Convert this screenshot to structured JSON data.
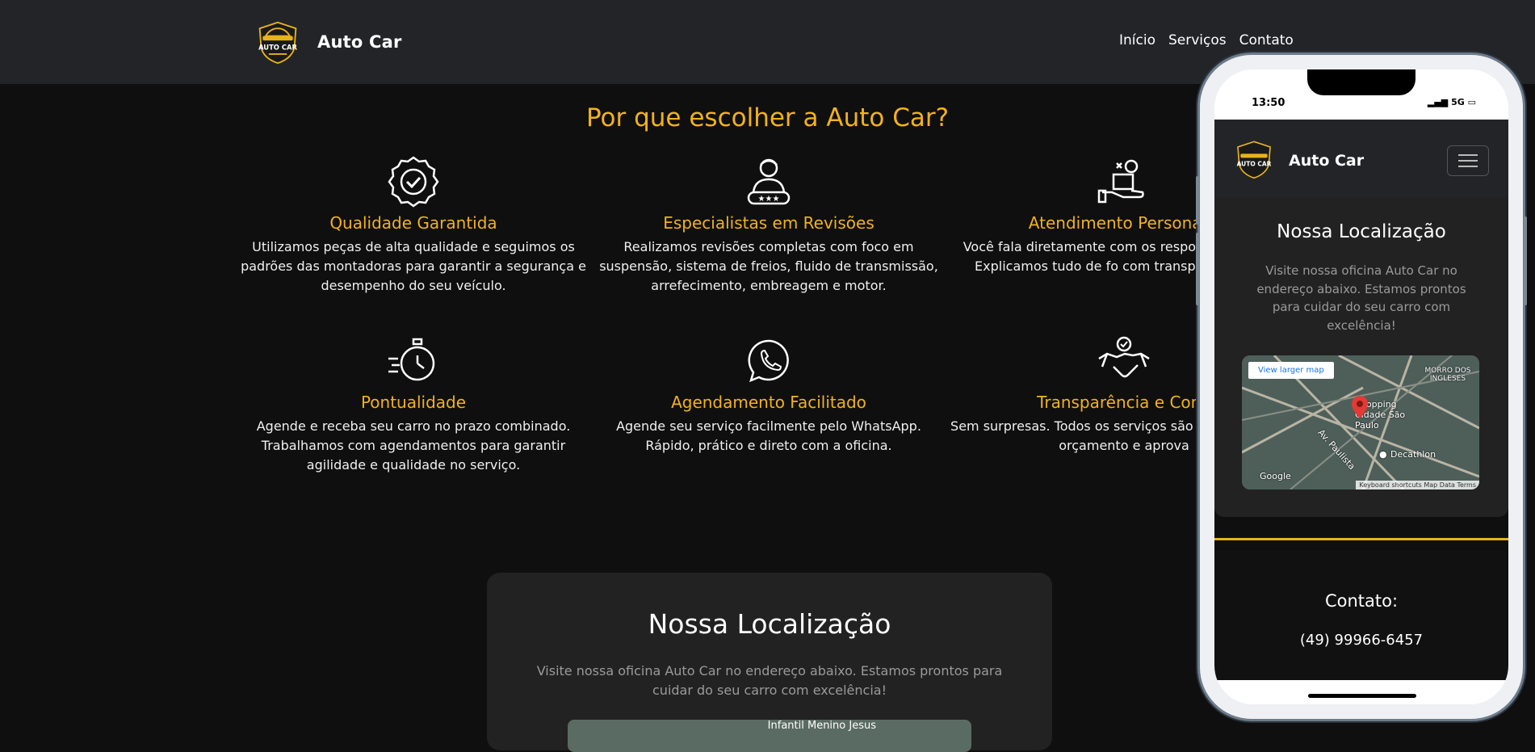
{
  "header": {
    "logo_text": "AUTO CAR",
    "brand": "Auto Car",
    "nav": [
      "Início",
      "Serviços",
      "Contato"
    ]
  },
  "why": {
    "title": "Por que escolher a Auto Car?",
    "features": [
      {
        "icon": "quality-badge-icon",
        "title": "Qualidade Garantida",
        "text": "Utilizamos peças de alta qualidade e seguimos os padrões das montadoras para garantir a segurança e desempenho do seu veículo."
      },
      {
        "icon": "specialist-icon",
        "title": "Especialistas em Revisões",
        "text": "Realizamos revisões completas com foco em suspensão, sistema de freios, fluido de transmissão, arrefecimento, embreagem e motor."
      },
      {
        "icon": "personal-service-icon",
        "title": "Atendimento Personaliz",
        "text": "Você fala diretamente com os respo manutenção. Explicamos tudo de fo com transparência tota"
      },
      {
        "icon": "stopwatch-icon",
        "title": "Pontualidade",
        "text": "Agende e receba seu carro no prazo combinado. Trabalhamos com agendamentos para garantir agilidade e qualidade no serviço."
      },
      {
        "icon": "whatsapp-icon",
        "title": "Agendamento Facilitado",
        "text": "Agende seu serviço facilmente pelo WhatsApp. Rápido, prático e direto com a oficina."
      },
      {
        "icon": "handshake-icon",
        "title": "Transparência e Confi",
        "text": "Sem surpresas. Todos os serviços são explicados com orçamento e aprova"
      }
    ]
  },
  "location": {
    "title": "Nossa Localização",
    "text": "Visite nossa oficina Auto Car no endereço abaixo. Estamos prontos para cuidar do seu carro com excelência!",
    "map_label": "Infantil Menino Jesus"
  },
  "phone": {
    "time": "13:50",
    "signal": "5G",
    "brand": "Auto Car",
    "location_title": "Nossa Localização",
    "location_text": "Visite nossa oficina Auto Car no endereço abaixo. Estamos prontos para cuidar do seu carro com excelência!",
    "map": {
      "larger_map": "View larger map",
      "place": "Shopping Cidade São Paulo",
      "store": "Decathlon",
      "street": "Av. Paulista",
      "area": "MORRO DOS INGLESES",
      "google": "Google",
      "footer": "Keyboard shortcuts   Map Data   Terms"
    },
    "contact_title": "Contato:",
    "phone_number": "(49) 99966-6457"
  },
  "colors": {
    "accent": "#f2b21b",
    "header_bg": "#222428",
    "page_bg": "#0f0f10",
    "card_bg": "#222222"
  }
}
